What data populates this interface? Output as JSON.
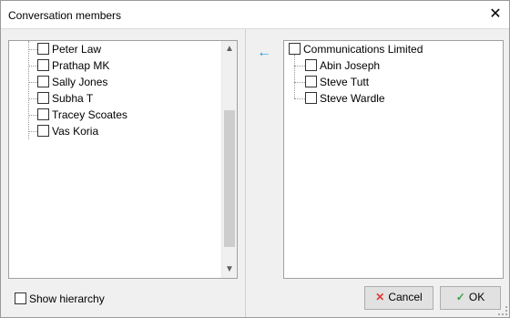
{
  "window": {
    "title": "Conversation members",
    "close_glyph": "✕"
  },
  "available": {
    "items": [
      "Peter Law",
      "Prathap MK",
      "Sally Jones",
      "Subha T",
      "Tracey Scoates",
      "Vas Koria"
    ],
    "scroll_up": "▲",
    "scroll_down": "▼"
  },
  "move_left_icon": "←",
  "selected": {
    "group": "Communications Limited",
    "items": [
      "Abin Joseph",
      "Steve Tutt",
      "Steve Wardle"
    ]
  },
  "show_hierarchy_label": "Show hierarchy",
  "buttons": {
    "cancel": "Cancel",
    "ok": "OK",
    "cancel_icon": "✕",
    "ok_icon": "✓"
  },
  "colors": {
    "accent": "#2f9ce0",
    "cancel": "#e53935",
    "ok": "#43a047"
  }
}
